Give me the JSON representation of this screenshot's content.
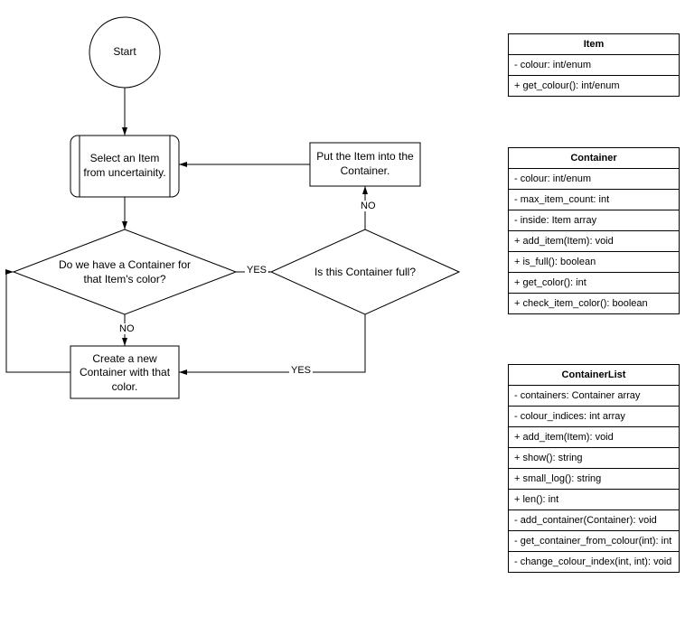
{
  "flow": {
    "start": "Start",
    "select": "Select an Item from uncertainity.",
    "decision1": "Do we have a Container for that Item's color?",
    "decision2": "Is this Container full?",
    "put": "Put the Item into the Container.",
    "create": "Create a new Container with that color.",
    "edges": {
      "yes1": "YES",
      "no1": "NO",
      "yes2": "YES",
      "no2": "NO"
    }
  },
  "classes": {
    "item": {
      "name": "Item",
      "attrs": [
        "- colour: int/enum"
      ],
      "methods": [
        "+ get_colour(): int/enum"
      ]
    },
    "container": {
      "name": "Container",
      "attrs": [
        "- colour: int/enum",
        "- max_item_count: int",
        "- inside: Item array"
      ],
      "methods": [
        "+ add_item(Item): void",
        "+ is_full(): boolean",
        "+ get_color(): int",
        "+ check_item_color(): boolean"
      ]
    },
    "containerList": {
      "name": "ContainerList",
      "attrs": [
        "- containers: Container array",
        "- colour_indices: int array"
      ],
      "methods": [
        "+ add_item(Item): void",
        "+ show(): string",
        "+ small_log(): string",
        "+ len(): int",
        "- add_container(Container): void",
        "- get_container_from_colour(int): int",
        "- change_colour_index(int, int): void"
      ]
    }
  },
  "chart_data": {
    "type": "diagram",
    "flowchart": {
      "nodes": [
        {
          "id": "start",
          "type": "terminator",
          "text": "Start"
        },
        {
          "id": "select",
          "type": "process",
          "text": "Select an Item from uncertainity."
        },
        {
          "id": "d1",
          "type": "decision",
          "text": "Do we have a Container for that Item's color?"
        },
        {
          "id": "d2",
          "type": "decision",
          "text": "Is this Container full?"
        },
        {
          "id": "put",
          "type": "process",
          "text": "Put the Item into the Container."
        },
        {
          "id": "create",
          "type": "process",
          "text": "Create a new Container with that color."
        }
      ],
      "edges": [
        {
          "from": "start",
          "to": "select"
        },
        {
          "from": "select",
          "to": "d1"
        },
        {
          "from": "d1",
          "to": "d2",
          "label": "YES"
        },
        {
          "from": "d1",
          "to": "create",
          "label": "NO"
        },
        {
          "from": "d2",
          "to": "put",
          "label": "NO"
        },
        {
          "from": "d2",
          "to": "create",
          "label": "YES"
        },
        {
          "from": "put",
          "to": "select"
        },
        {
          "from": "create",
          "to": "d1"
        }
      ]
    },
    "uml_classes": [
      {
        "name": "Item",
        "attributes": [
          "- colour: int/enum"
        ],
        "methods": [
          "+ get_colour(): int/enum"
        ]
      },
      {
        "name": "Container",
        "attributes": [
          "- colour: int/enum",
          "- max_item_count: int",
          "- inside: Item array"
        ],
        "methods": [
          "+ add_item(Item): void",
          "+ is_full(): boolean",
          "+ get_color(): int",
          "+ check_item_color(): boolean"
        ]
      },
      {
        "name": "ContainerList",
        "attributes": [
          "- containers: Container array",
          "- colour_indices: int array"
        ],
        "methods": [
          "+ add_item(Item): void",
          "+ show(): string",
          "+ small_log(): string",
          "+ len(): int",
          "- add_container(Container): void",
          "- get_container_from_colour(int): int",
          "- change_colour_index(int, int): void"
        ]
      }
    ]
  }
}
